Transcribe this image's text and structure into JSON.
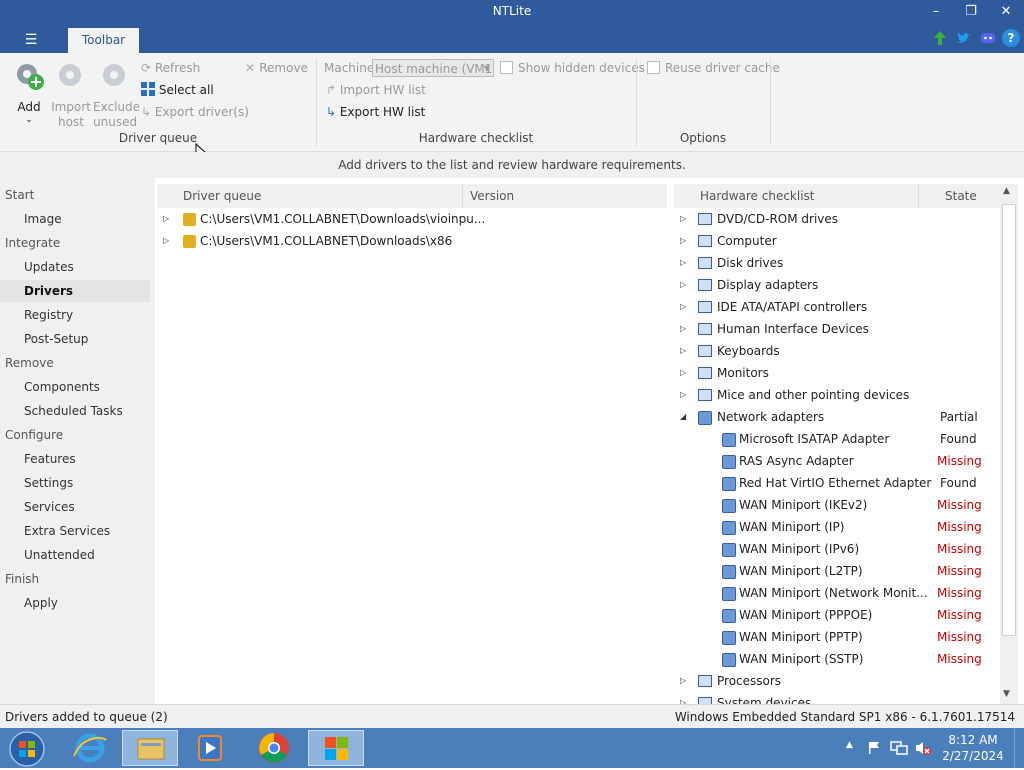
{
  "window": {
    "title": "NTLite",
    "controls": {
      "minimize": "–",
      "maximize": "❐",
      "close": "✕"
    },
    "menu_icon": "☰",
    "tab": "Toolbar",
    "top_icons": [
      "arrow-up-icon",
      "twitter-icon",
      "discord-icon",
      "help-icon"
    ],
    "help_glyph": "?"
  },
  "ribbon": {
    "driver_queue": {
      "label": "Driver queue",
      "add": "Add",
      "import_host_1": "Import",
      "import_host_2": "host",
      "exclude_unused_1": "Exclude",
      "exclude_unused_2": "unused",
      "refresh": "Refresh",
      "select_all": "Select all",
      "export_drivers": "Export driver(s)",
      "remove": "Remove"
    },
    "hardware_checklist": {
      "label": "Hardware checklist",
      "machine_label": "Machine",
      "machine_value": "Host machine (VM1",
      "show_hidden": "Show hidden devices",
      "import_hw": "Import HW list",
      "export_hw": "Export HW list"
    },
    "options": {
      "label": "Options",
      "reuse_cache": "Reuse driver cache"
    }
  },
  "hint": "Add drivers to the list and review hardware requirements.",
  "nav": {
    "start": "Start",
    "image": "Image",
    "integrate": "Integrate",
    "updates": "Updates",
    "drivers": "Drivers",
    "registry": "Registry",
    "post_setup": "Post-Setup",
    "remove": "Remove",
    "components": "Components",
    "scheduled_tasks": "Scheduled Tasks",
    "configure": "Configure",
    "features": "Features",
    "settings": "Settings",
    "services": "Services",
    "extra_services": "Extra Services",
    "unattended": "Unattended",
    "finish": "Finish",
    "apply": "Apply"
  },
  "queue": {
    "col_name": "Driver queue",
    "col_version": "Version",
    "rows": [
      {
        "path": "C:\\Users\\VM1.COLLABNET\\Downloads\\vioinpu..."
      },
      {
        "path": "C:\\Users\\VM1.COLLABNET\\Downloads\\x86"
      }
    ]
  },
  "hw": {
    "col_name": "Hardware checklist",
    "col_state": "State",
    "rows": [
      {
        "name": "DVD/CD-ROM drives",
        "state": ""
      },
      {
        "name": "Computer",
        "state": ""
      },
      {
        "name": "Disk drives",
        "state": ""
      },
      {
        "name": "Display adapters",
        "state": ""
      },
      {
        "name": "IDE ATA/ATAPI controllers",
        "state": ""
      },
      {
        "name": "Human Interface Devices",
        "state": ""
      },
      {
        "name": "Keyboards",
        "state": ""
      },
      {
        "name": "Monitors",
        "state": ""
      },
      {
        "name": "Mice and other pointing devices",
        "state": ""
      },
      {
        "name": "Network adapters",
        "state": "Partial"
      },
      {
        "name": "Microsoft ISATAP Adapter",
        "state": "Found"
      },
      {
        "name": "RAS Async Adapter",
        "state": "Missing"
      },
      {
        "name": "Red Hat VirtIO Ethernet Adapter",
        "state": "Found"
      },
      {
        "name": "WAN Miniport (IKEv2)",
        "state": "Missing"
      },
      {
        "name": "WAN Miniport (IP)",
        "state": "Missing"
      },
      {
        "name": "WAN Miniport (IPv6)",
        "state": "Missing"
      },
      {
        "name": "WAN Miniport (L2TP)",
        "state": "Missing"
      },
      {
        "name": "WAN Miniport (Network Monit...",
        "state": "Missing"
      },
      {
        "name": "WAN Miniport (PPPOE)",
        "state": "Missing"
      },
      {
        "name": "WAN Miniport (PPTP)",
        "state": "Missing"
      },
      {
        "name": "WAN Miniport (SSTP)",
        "state": "Missing"
      },
      {
        "name": "Processors",
        "state": ""
      },
      {
        "name": "System devices",
        "state": ""
      }
    ]
  },
  "status": {
    "left": "Drivers added to queue (2)",
    "right": "Windows Embedded Standard SP1 x86 - 6.1.7601.17514"
  },
  "taskbar": {
    "apps": [
      "start-orb-icon",
      "internet-explorer-icon",
      "file-explorer-icon",
      "media-player-icon",
      "chrome-icon",
      "ntlite-icon"
    ],
    "time": "8:12 AM",
    "date": "2/27/2024",
    "colors": {
      "accent": "#2f5b9c",
      "missing": "#cc0000"
    }
  }
}
